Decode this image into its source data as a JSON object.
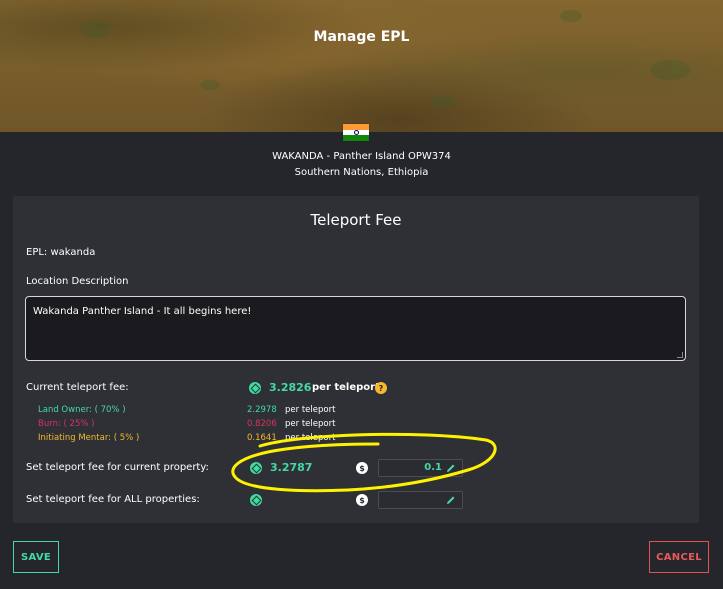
{
  "header": {
    "title": "Manage EPL"
  },
  "property": {
    "flag": "india-flag-icon",
    "name": "WAKANDA - Panther Island OPW374",
    "region": "Southern Nations, Ethiopia"
  },
  "panel": {
    "title": "Teleport Fee",
    "epl_label": "EPL: wakanda",
    "location_label": "Location Description",
    "location_value": "Wakanda Panther Island - It all begins here!"
  },
  "current_fee": {
    "label": "Current teleport fee:",
    "value": "3.2826",
    "unit": "per teleport",
    "help": "?",
    "breakdown": [
      {
        "label": "Land Owner: ( 70% )",
        "value": "2.2978",
        "unit": "per teleport",
        "color": "#43d9a3"
      },
      {
        "label": "Burn: ( 25% )",
        "value": "0.8206",
        "unit": "per teleport",
        "color": "#d6335f"
      },
      {
        "label": "Initiating Mentar: ( 5% )",
        "value": "0.1641",
        "unit": "per teleport",
        "color": "#f5b82e"
      }
    ]
  },
  "set_current": {
    "label": "Set teleport fee for current property:",
    "coin_value": "3.2787",
    "input_value": "0.1",
    "currency_symbol": "$"
  },
  "set_all": {
    "label": "Set teleport fee for ALL properties:",
    "input_value": "",
    "currency_symbol": "$"
  },
  "actions": {
    "save_label": "SAVE",
    "cancel_label": "CANCEL"
  },
  "colors": {
    "accent": "#43d9a3",
    "danger": "#e85a5a",
    "warning": "#f5b82e",
    "annotation": "#fff200"
  }
}
